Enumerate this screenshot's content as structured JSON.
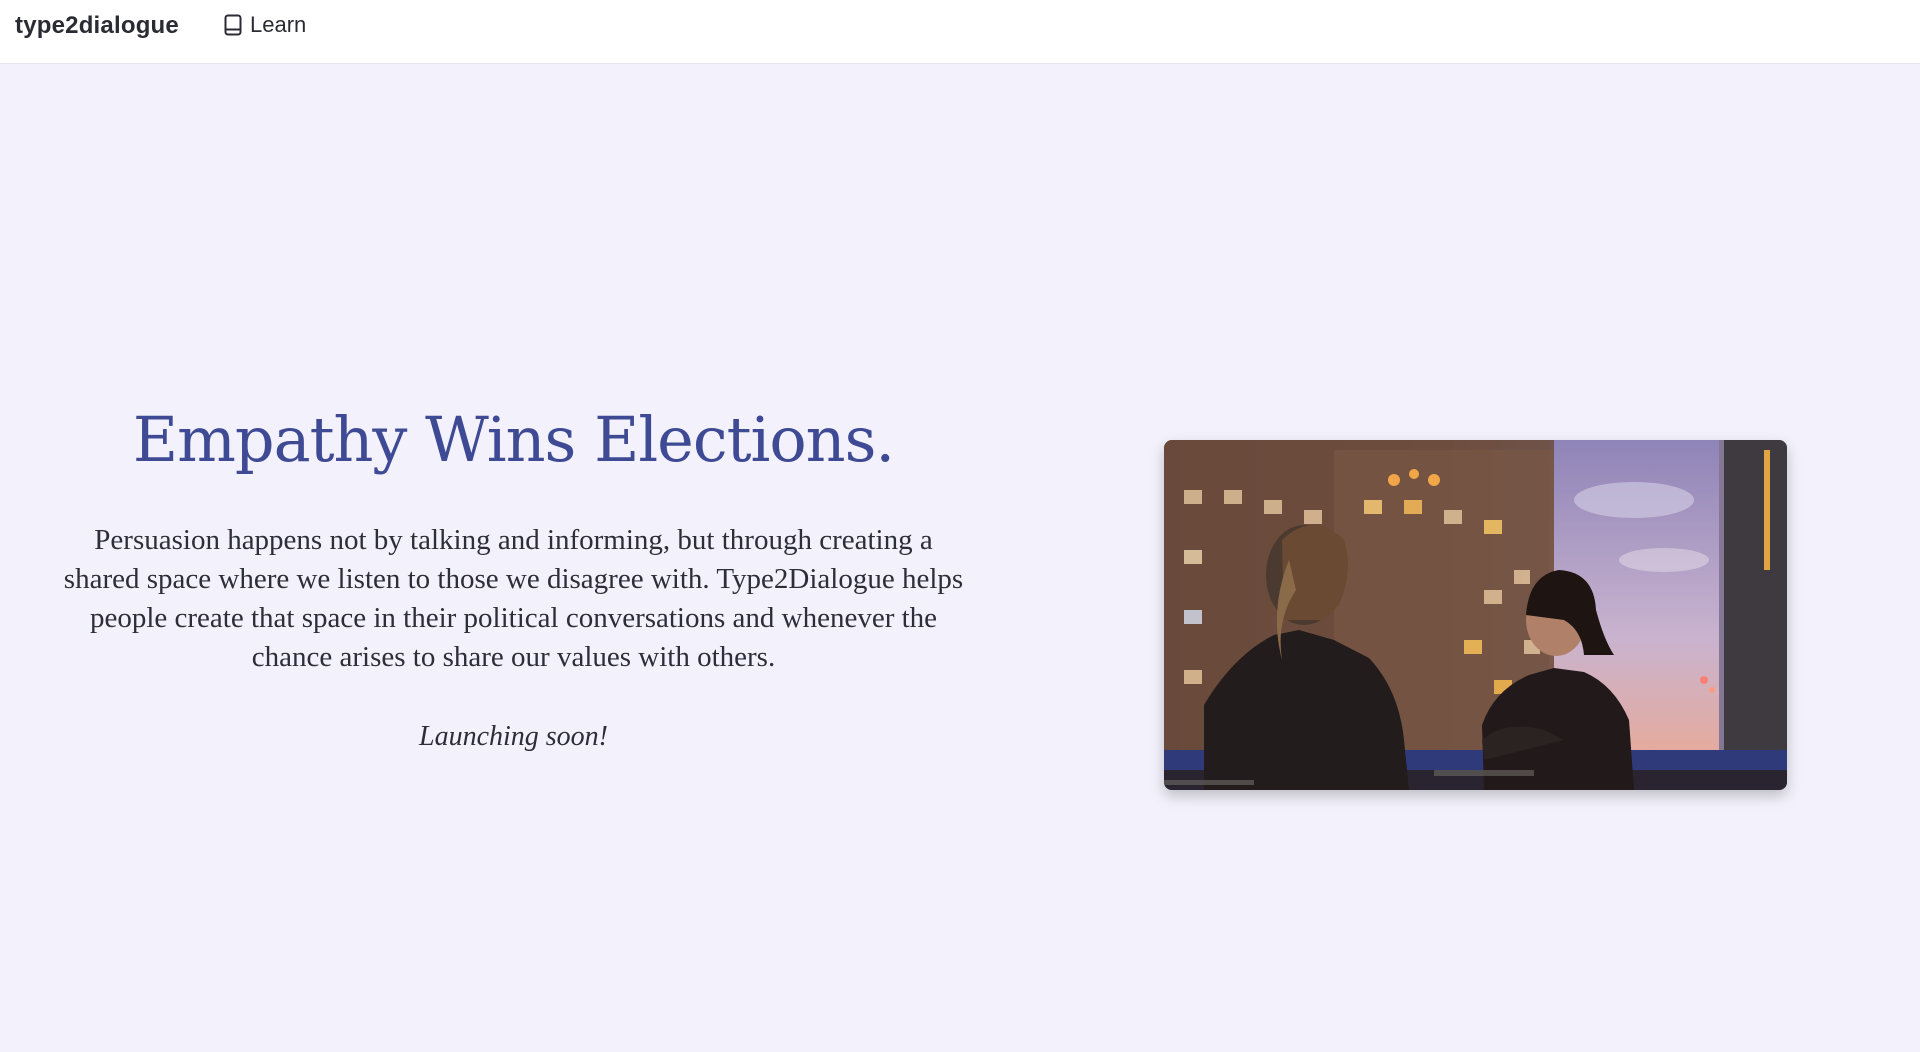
{
  "header": {
    "brand": "type2dialogue",
    "nav": [
      {
        "label": "Learn",
        "icon": "book-icon"
      }
    ]
  },
  "hero": {
    "headline": "Empathy Wins Elections.",
    "body": "Persuasion happens not by talking and informing, but through creating a shared space where we listen to those we disagree with. Type2Dialogue helps people create that space in their political conversations and whenever the chance arises to share our values with others.",
    "tagline": "Launching soon!"
  },
  "colors": {
    "background": "#f3f1fb",
    "header_bg": "#ffffff",
    "headline": "#3f4a95",
    "text": "#2e2e3a"
  }
}
